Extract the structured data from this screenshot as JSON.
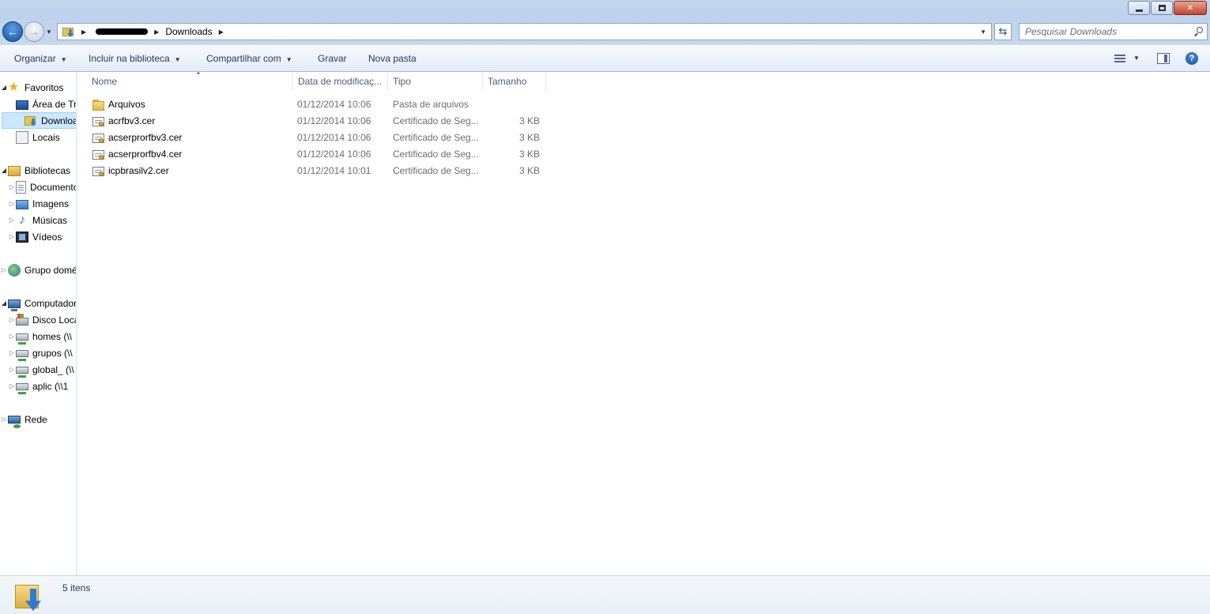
{
  "address": {
    "current_folder": "Downloads"
  },
  "search": {
    "placeholder": "Pesquisar Downloads"
  },
  "toolbar": {
    "organize": "Organizar",
    "include_library": "Incluir na biblioteca",
    "share_with": "Compartilhar com",
    "burn": "Gravar",
    "new_folder": "Nova pasta"
  },
  "navpane": {
    "favorites": "Favoritos",
    "desktop": "Área de Tr",
    "downloads": "Downloads",
    "places": "Locais",
    "libraries": "Bibliotecas",
    "documents": "Documentos",
    "images": "Imagens",
    "music": "Músicas",
    "videos": "Vídeos",
    "homegroup": "Grupo doméstico",
    "computer": "Computador",
    "local_disk": "Disco Local",
    "homes": "homes (\\\\",
    "grupos": "grupos (\\\\",
    "global": "global_ (\\\\",
    "aplic": "aplic (\\\\1",
    "network": "Rede"
  },
  "columns": {
    "name": "Nome",
    "date": "Data de modificaç...",
    "type": "Tipo",
    "size": "Tamanho"
  },
  "files": [
    {
      "name": "Arquivos",
      "date": "01/12/2014 10:06",
      "type": "Pasta de arquivos",
      "size": "",
      "icon": "folder-icon"
    },
    {
      "name": "acrfbv3.cer",
      "date": "01/12/2014 10:06",
      "type": "Certificado de Seg...",
      "size": "3 KB",
      "icon": "certificate-icon"
    },
    {
      "name": "acserprorfbv3.cer",
      "date": "01/12/2014 10:06",
      "type": "Certificado de Seg...",
      "size": "3 KB",
      "icon": "certificate-icon"
    },
    {
      "name": "acserprorfbv4.cer",
      "date": "01/12/2014 10:06",
      "type": "Certificado de Seg...",
      "size": "3 KB",
      "icon": "certificate-icon"
    },
    {
      "name": "icpbrasilv2.cer",
      "date": "01/12/2014 10:01",
      "type": "Certificado de Seg...",
      "size": "3 KB",
      "icon": "certificate-icon"
    }
  ],
  "status": {
    "item_count": "5 itens"
  }
}
